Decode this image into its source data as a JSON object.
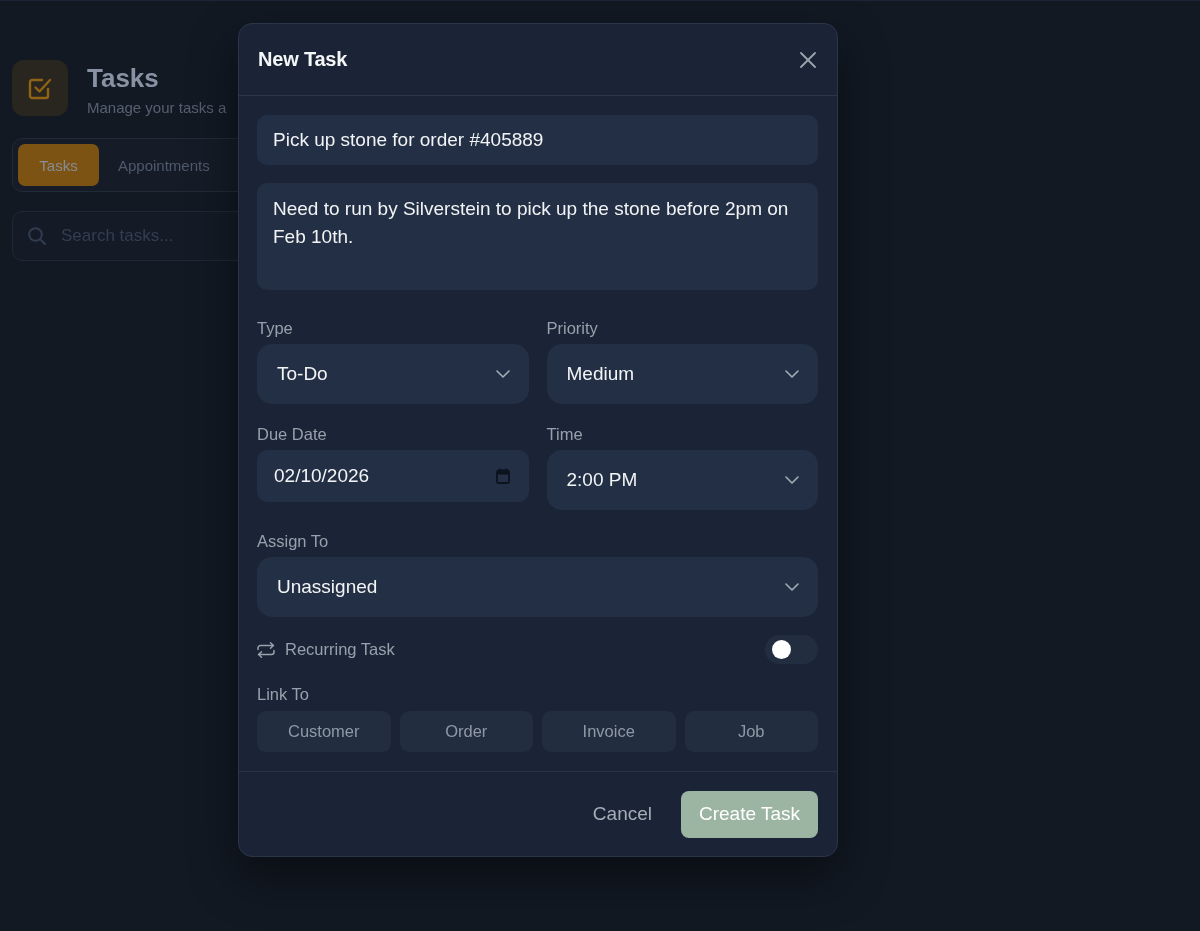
{
  "app": {
    "title": "Tasks",
    "subtitle": "Manage your tasks a",
    "tabs": [
      {
        "label": "Tasks",
        "selected": true
      },
      {
        "label": "Appointments",
        "selected": false
      }
    ],
    "search": {
      "placeholder": "Search tasks..."
    }
  },
  "dialog": {
    "title": "New Task",
    "title_field": {
      "value": "Pick up stone for order #405889"
    },
    "description_field": {
      "value": "Need to run by Silverstein to pick up the stone before 2pm on Feb 10th."
    },
    "field_rows": [
      [
        {
          "kind": "select",
          "label": "Type",
          "value": "To-Do"
        },
        {
          "kind": "select",
          "label": "Priority",
          "value": "Medium"
        }
      ],
      [
        {
          "kind": "date",
          "label": "Due Date",
          "value": "02/10/2026"
        },
        {
          "kind": "select",
          "label": "Time",
          "value": "2:00 PM"
        }
      ],
      [
        {
          "kind": "select",
          "label": "Assign To",
          "value": "Unassigned"
        }
      ]
    ],
    "recurring": {
      "label": "Recurring Task",
      "on": false
    },
    "link_to": {
      "label": "Link To",
      "options": [
        {
          "label": "Customer",
          "selected": false
        },
        {
          "label": "Order",
          "selected": false
        },
        {
          "label": "Invoice",
          "selected": false
        },
        {
          "label": "Job",
          "selected": false
        }
      ]
    },
    "actions": [
      {
        "kind": "cancel",
        "label": "Cancel"
      },
      {
        "kind": "submit",
        "label": "Create Task"
      }
    ]
  }
}
